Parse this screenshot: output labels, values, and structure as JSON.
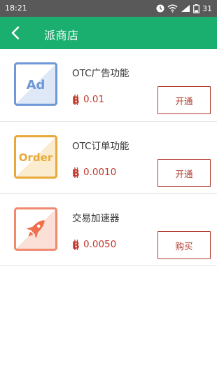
{
  "status_bar": {
    "time": "18:21",
    "battery": "31"
  },
  "header": {
    "title": "派商店"
  },
  "colors": {
    "header": "#1aae6f",
    "price": "#c0392b",
    "button": "#b03a2e"
  },
  "items": [
    {
      "name": "OTC广告功能",
      "price": "0.01",
      "button": "开通",
      "icon_label": "Ad",
      "icon": "ad-icon"
    },
    {
      "name": "OTC订单功能",
      "price": "0.0010",
      "button": "开通",
      "icon_label": "Order",
      "icon": "order-icon"
    },
    {
      "name": "交易加速器",
      "price": "0.0050",
      "button": "购买",
      "icon": "rocket-icon"
    }
  ]
}
